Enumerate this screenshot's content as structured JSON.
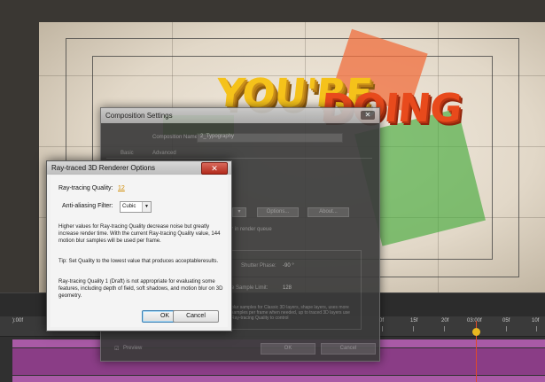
{
  "headline": {
    "word1": "YOU'RE",
    "word2": "DOING"
  },
  "composition_settings": {
    "title": "Composition Settings",
    "close_label": "✕",
    "name_label": "Composition Name:",
    "name_value": "2_Typography",
    "tabs": [
      "Basic",
      "Advanced"
    ],
    "options_button": "Options...",
    "about_button": "About...",
    "render_queue_text": "r in render queue",
    "shutter_phase_label": "Shutter Phase:",
    "shutter_phase_value": "-90 °",
    "sample_limit_label": "e Sample Limit:",
    "sample_limit_value": "128",
    "info_text": "blur samples for Classic 3D layers, shape layers, uses more samples per frame when needed, up to traced 3D layers use Ray-tracing Quality to control",
    "preview_label": "Preview",
    "ok_label": "OK",
    "cancel_label": "Cancel"
  },
  "raytraced_dialog": {
    "title": "Ray-traced 3D Renderer Options",
    "close_label": "✕",
    "quality_label": "Ray-tracing Quality:",
    "quality_value": "12",
    "filter_label": "Anti-aliasing Filter:",
    "filter_value": "Cubic",
    "para1": "Higher values for Ray-tracing Quality decrease noise but greatly increase render time. With the current Ray-tracing Quality value, 144 motion blur samples will be used per frame.",
    "para2": "Tip: Set Quality to the lowest value that produces acceptableresults.",
    "para3": "Ray-tracing Quality 1 (Draft) is not appropriate for evaluating some features, including depth of field, soft shadows, and motion blur on 3D geometry.",
    "ok_label": "OK",
    "cancel_label": "Cancel"
  },
  "timeline": {
    "start_label": "):00f",
    "tick_labels": [
      "0f",
      "15f",
      "20f",
      "03:00f",
      "05f",
      "10f"
    ]
  },
  "colors": {
    "layer_bar": "#a95aa6",
    "cti": "#e8b820",
    "accent_quality": "#d08a00"
  }
}
